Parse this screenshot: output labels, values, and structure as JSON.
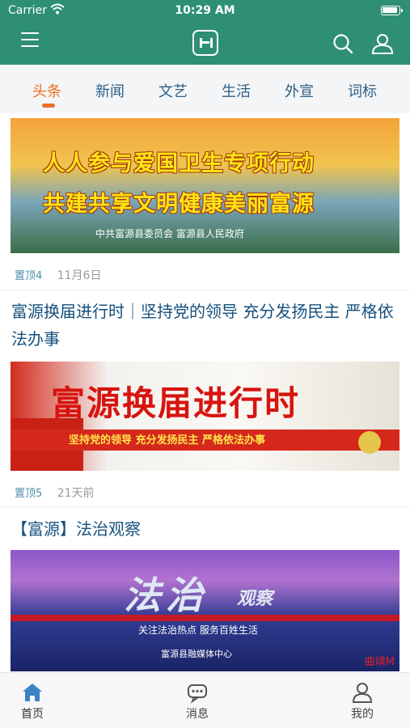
{
  "status_bar": {
    "carrier": "Carrier",
    "time": "10:29 AM"
  },
  "app_bar": {
    "menu_icon": "menu-icon",
    "logo_icon": "app-logo-icon",
    "search_icon": "search-icon",
    "user_icon": "user-icon",
    "color": "#2e8f74"
  },
  "tabs": [
    {
      "label": "头条",
      "active": true
    },
    {
      "label": "新闻",
      "active": false
    },
    {
      "label": "文艺",
      "active": false
    },
    {
      "label": "生活",
      "active": false
    },
    {
      "label": "外宣",
      "active": false
    },
    {
      "label": "词标",
      "active": false
    }
  ],
  "accent_color": "#ef6e25",
  "feed": {
    "item1": {
      "banner_line1": "人人参与爱国卫生专项行动",
      "banner_line2": "共建共享文明健康美丽富源",
      "banner_line3": "中共富源县委员会    富源县人民政府",
      "pin": "置顶4",
      "time": "11月6日"
    },
    "item2": {
      "title": "富源换届进行时｜坚持党的领导 充分发扬民主 严格依法办事",
      "banner_line1": "富源换届进行时",
      "banner_line2": "坚持党的领导  充分发扬民主  严格依法办事",
      "pin": "置顶5",
      "time": "21天前"
    },
    "item3": {
      "title": "【富源】法治观察",
      "banner_big": "法治",
      "banner_sub": "观察",
      "banner_line3": "关注法治热点  服务百姓生活",
      "banner_line4": "富源县融媒体中心",
      "watermark": "曲靖M"
    }
  },
  "bottom_nav": [
    {
      "label": "首页",
      "icon": "home-icon",
      "active": true
    },
    {
      "label": "消息",
      "icon": "message-icon",
      "active": false
    },
    {
      "label": "我的",
      "icon": "profile-icon",
      "active": false
    }
  ]
}
